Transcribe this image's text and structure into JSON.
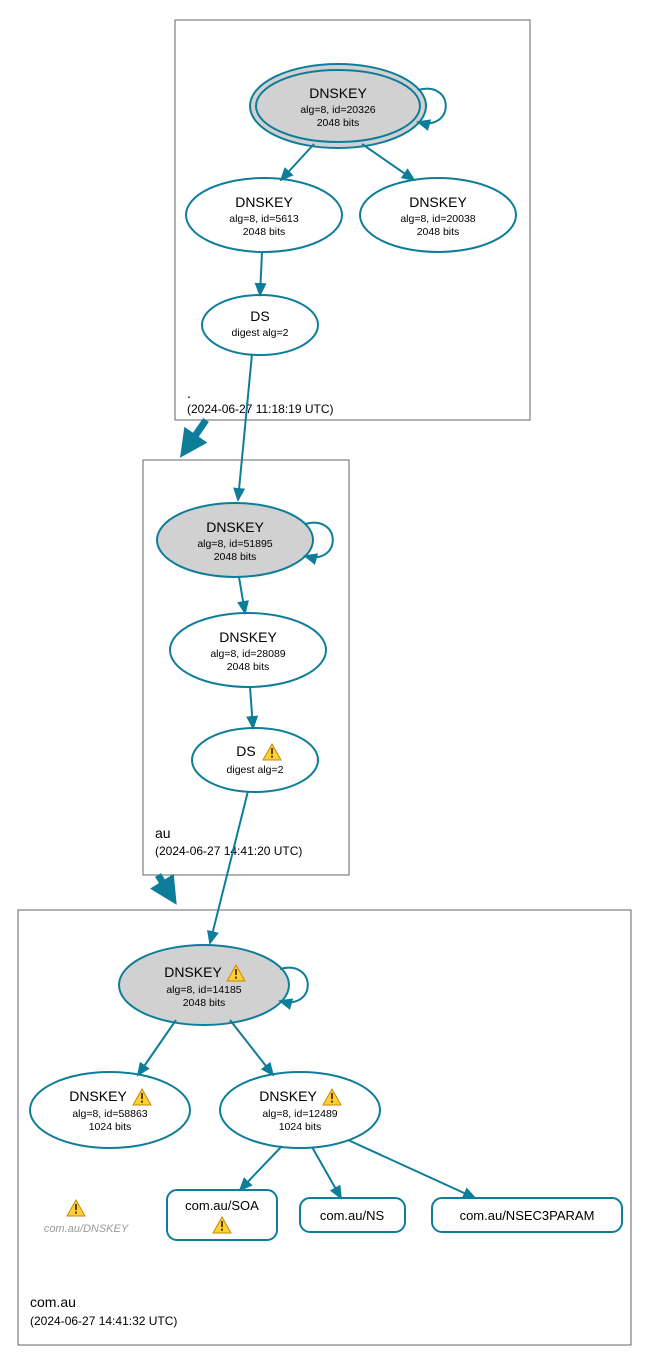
{
  "chart_data": {
    "type": "diagram",
    "description": "DNSSEC delegation / signing graph (DNSViz-style)",
    "zones": [
      {
        "name": ".",
        "timestamp": "(2024-06-27 11:18:19 UTC)",
        "nodes": [
          {
            "id": "root_ksk",
            "type": "DNSKEY",
            "ksk": true,
            "alg": 8,
            "keyid": 20326,
            "bits": 2048,
            "warning": false
          },
          {
            "id": "root_zsk1",
            "type": "DNSKEY",
            "ksk": false,
            "alg": 8,
            "keyid": 5613,
            "bits": 2048,
            "warning": false
          },
          {
            "id": "root_zsk2",
            "type": "DNSKEY",
            "ksk": false,
            "alg": 8,
            "keyid": 20038,
            "bits": 2048,
            "warning": false
          },
          {
            "id": "root_ds",
            "type": "DS",
            "digest_alg": 2,
            "warning": false
          }
        ],
        "edges": [
          {
            "from": "root_ksk",
            "to": "root_ksk"
          },
          {
            "from": "root_ksk",
            "to": "root_zsk1"
          },
          {
            "from": "root_ksk",
            "to": "root_zsk2"
          },
          {
            "from": "root_zsk1",
            "to": "root_ds"
          }
        ]
      },
      {
        "name": "au",
        "timestamp": "(2024-06-27 14:41:20 UTC)",
        "nodes": [
          {
            "id": "au_ksk",
            "type": "DNSKEY",
            "ksk": true,
            "alg": 8,
            "keyid": 51895,
            "bits": 2048,
            "warning": false
          },
          {
            "id": "au_zsk",
            "type": "DNSKEY",
            "ksk": false,
            "alg": 8,
            "keyid": 28089,
            "bits": 2048,
            "warning": false
          },
          {
            "id": "au_ds",
            "type": "DS",
            "digest_alg": 2,
            "warning": true
          }
        ],
        "edges": [
          {
            "from": "au_ksk",
            "to": "au_ksk"
          },
          {
            "from": "au_ksk",
            "to": "au_zsk"
          },
          {
            "from": "au_zsk",
            "to": "au_ds"
          }
        ]
      },
      {
        "name": "com.au",
        "timestamp": "(2024-06-27 14:41:32 UTC)",
        "nodes": [
          {
            "id": "comau_ksk",
            "type": "DNSKEY",
            "ksk": true,
            "alg": 8,
            "keyid": 14185,
            "bits": 2048,
            "warning": true
          },
          {
            "id": "comau_zsk1",
            "type": "DNSKEY",
            "ksk": false,
            "alg": 8,
            "keyid": 58863,
            "bits": 1024,
            "warning": true
          },
          {
            "id": "comau_zsk2",
            "type": "DNSKEY",
            "ksk": false,
            "alg": 8,
            "keyid": 12489,
            "bits": 1024,
            "warning": true
          },
          {
            "id": "comau_dnskey_label",
            "type": "LABEL",
            "text": "com.au/DNSKEY",
            "warning": true
          }
        ],
        "rrsets": [
          {
            "id": "comau_soa",
            "label": "com.au/SOA",
            "warning": true
          },
          {
            "id": "comau_ns",
            "label": "com.au/NS",
            "warning": false
          },
          {
            "id": "comau_nsec3",
            "label": "com.au/NSEC3PARAM",
            "warning": false
          }
        ],
        "edges": [
          {
            "from": "comau_ksk",
            "to": "comau_ksk"
          },
          {
            "from": "comau_ksk",
            "to": "comau_zsk1"
          },
          {
            "from": "comau_ksk",
            "to": "comau_zsk2"
          },
          {
            "from": "comau_zsk2",
            "to": "comau_soa"
          },
          {
            "from": "comau_zsk2",
            "to": "comau_ns"
          },
          {
            "from": "comau_zsk2",
            "to": "comau_nsec3"
          }
        ]
      }
    ],
    "cross_zone_edges": [
      {
        "from": "root_ds",
        "to": "au_ksk",
        "thick_hint": true
      },
      {
        "from": "au_ds",
        "to": "comau_ksk",
        "thick_hint": true
      }
    ]
  },
  "labels": {
    "dnskey": "DNSKEY",
    "ds": "DS",
    "alg_prefix": "alg=",
    "id_prefix": "id=",
    "bits_suffix": " bits",
    "digest_prefix": "digest alg="
  }
}
